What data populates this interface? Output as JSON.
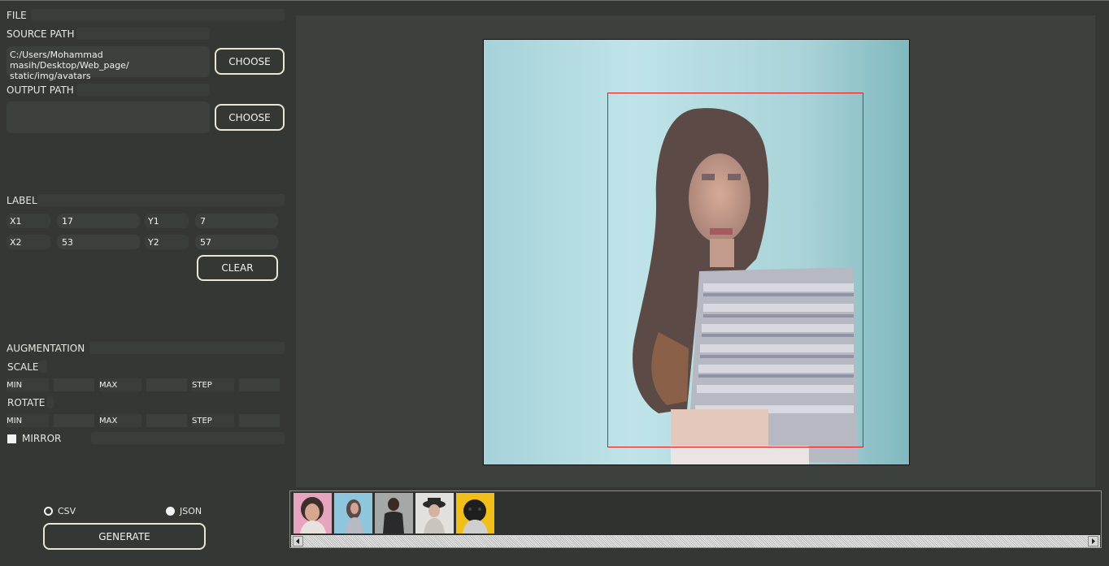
{
  "file": {
    "section_title": "FILE",
    "source_path_label": "SOURCE PATH",
    "source_path_value": "C:/Users/Mohammad masih/Desktop/Web_page/\nstatic/img/avatars",
    "source_choose_label": "CHOOSE",
    "output_path_label": "OUTPUT PATH",
    "output_path_value": "",
    "output_choose_label": "CHOOSE"
  },
  "label": {
    "section_title": "LABEL",
    "x1_label": "X1",
    "x1_value": "17",
    "y1_label": "Y1",
    "y1_value": "7",
    "x2_label": "X2",
    "x2_value": "53",
    "y2_label": "Y2",
    "y2_value": "57",
    "clear_label": "CLEAR"
  },
  "augmentation": {
    "section_title": "AUGMENTATION",
    "scale": {
      "label": "SCALE",
      "min_label": "MIN",
      "min_value": "",
      "max_label": "MAX",
      "max_value": "",
      "step_label": "STEP",
      "step_value": ""
    },
    "rotate": {
      "label": "ROTATE",
      "min_label": "MIN",
      "min_value": "",
      "max_label": "MAX",
      "max_value": "",
      "step_label": "STEP",
      "step_value": ""
    },
    "mirror_label": "MIRROR",
    "mirror_checked": false
  },
  "export": {
    "csv_label": "CSV",
    "csv_selected": false,
    "json_label": "JSON",
    "json_selected": true,
    "generate_label": "GENERATE"
  },
  "thumbnails": [
    {
      "name": "avatar-woman-pink-background",
      "bg": "#e8a3bf"
    },
    {
      "name": "avatar-woman-blue-background",
      "bg": "#8ec6de"
    },
    {
      "name": "avatar-man-gray-background",
      "bg": "#a5a8a7"
    },
    {
      "name": "avatar-woman-hat",
      "bg": "#e2e0dc"
    },
    {
      "name": "avatar-dog-yellow-background",
      "bg": "#f0bf1a"
    }
  ],
  "colors": {
    "background": "#343734",
    "panel": "#3d413d",
    "bbox": "#e01b1b",
    "accent_border": "#e9e6d6"
  }
}
